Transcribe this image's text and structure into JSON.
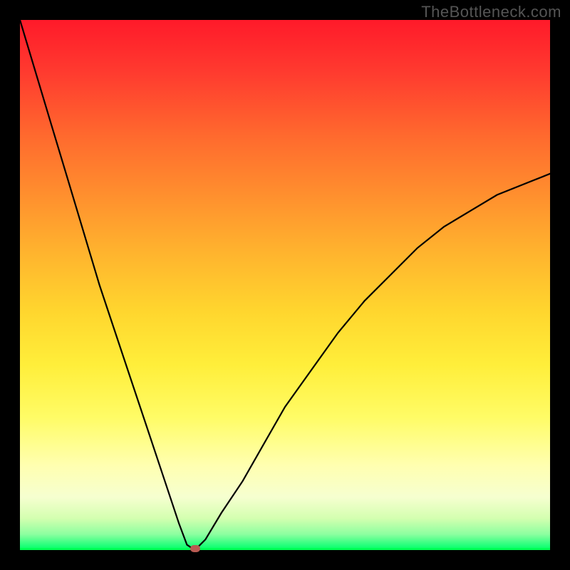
{
  "watermark": "TheBottleneck.com",
  "chart_data": {
    "type": "line",
    "title": "",
    "xlabel": "",
    "ylabel": "",
    "xlim": [
      0,
      100
    ],
    "ylim": [
      0,
      100
    ],
    "series": [
      {
        "name": "bottleneck-curve",
        "x": [
          0,
          3,
          6,
          9,
          12,
          15,
          18,
          21,
          24,
          27,
          30,
          31.5,
          33,
          35,
          38,
          42,
          46,
          50,
          55,
          60,
          65,
          70,
          75,
          80,
          85,
          90,
          95,
          100
        ],
        "y": [
          100,
          90,
          80,
          70,
          60,
          50,
          41,
          32,
          23,
          14,
          5,
          1,
          0,
          2,
          7,
          13,
          20,
          27,
          34,
          41,
          47,
          52,
          57,
          61,
          64,
          67,
          69,
          71
        ]
      }
    ],
    "marker": {
      "x": 33,
      "y": 0,
      "name": "optimal-point"
    },
    "gradient_stops": [
      {
        "pos": 0,
        "color": "#ff1a2a"
      },
      {
        "pos": 50,
        "color": "#ffd62e"
      },
      {
        "pos": 85,
        "color": "#ffffb0"
      },
      {
        "pos": 100,
        "color": "#00ff66"
      }
    ]
  }
}
